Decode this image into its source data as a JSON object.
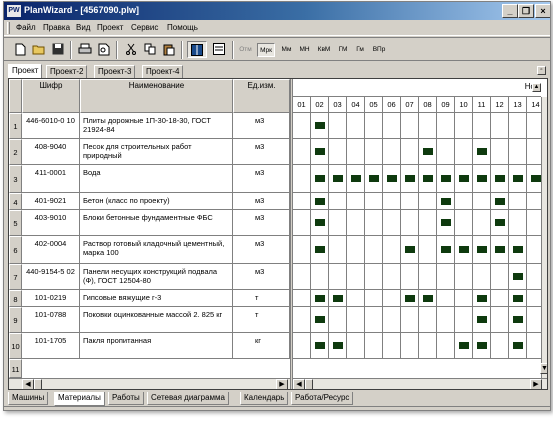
{
  "window": {
    "app_icon": "PW",
    "title": "PlanWizard - [4567090.plw]",
    "controls": [
      {
        "name": "minimize-button",
        "glyph": "_"
      },
      {
        "name": "restore-button",
        "glyph": "❐"
      },
      {
        "name": "close-button",
        "glyph": "×"
      }
    ]
  },
  "menu": {
    "items": [
      "Файл",
      "Правка",
      "Вид",
      "Проект",
      "Сервис",
      "Помощь"
    ]
  },
  "toolbar": {
    "buttons": [
      {
        "name": "new-file-icon"
      },
      {
        "name": "open-folder-icon"
      },
      {
        "name": "save-icon"
      },
      {
        "name": "print-icon"
      },
      {
        "name": "print-preview-icon"
      },
      {
        "name": "cut-icon"
      },
      {
        "name": "copy-icon"
      },
      {
        "name": "paste-icon"
      },
      {
        "name": "table-view-icon",
        "pressed": true
      },
      {
        "name": "chart-view-icon",
        "pressed": false
      }
    ],
    "scales": [
      {
        "label": "Отм",
        "state": "disabled"
      },
      {
        "label": "Мрк",
        "state": "selected"
      },
      {
        "label": "Мм",
        "state": "normal"
      },
      {
        "label": "МН",
        "state": "normal"
      },
      {
        "label": "КвМ",
        "state": "normal"
      },
      {
        "label": "ГМ",
        "state": "normal"
      },
      {
        "label": "Гм",
        "state": "normal"
      },
      {
        "label": "ВПр",
        "state": "normal"
      }
    ]
  },
  "project_tabs": [
    "Проект",
    "Проект-2",
    "Проект-3",
    "Проект-4"
  ],
  "active_project_tab": 0,
  "table": {
    "headers": {
      "code": "Шифр",
      "name": "Наименование",
      "unit": "Ед.изм."
    },
    "rows": [
      {
        "num": "1",
        "code": "446-6010-0 10",
        "name": "Плиты дорожные 1П-30-18-30, ГОСТ 21924-84",
        "unit": "м3",
        "bars": [
          2
        ]
      },
      {
        "num": "2",
        "code": "408-9040",
        "name": "Песок для строительных работ природный",
        "unit": "м3",
        "bars": [
          2,
          8,
          11
        ]
      },
      {
        "num": "3",
        "code": "411-0001",
        "name": "Вода",
        "unit": "м3",
        "bars": [
          2,
          3,
          4,
          5,
          6,
          7,
          8,
          9,
          10,
          11,
          12,
          13,
          14
        ]
      },
      {
        "num": "4",
        "code": "401-9021",
        "name": "Бетон  (класс по проекту)",
        "unit": "м3",
        "bars": [
          2,
          9,
          12
        ]
      },
      {
        "num": "5",
        "code": "403-9010",
        "name": "Блоки бетонные фундаментные ФБС",
        "unit": "м3",
        "bars": [
          2,
          9,
          12
        ]
      },
      {
        "num": "6",
        "code": "402-0004",
        "name": "Раствор готовый кладочный цементный, марка 100",
        "unit": "м3",
        "bars": [
          2,
          7,
          9,
          10,
          11,
          12,
          13
        ]
      },
      {
        "num": "7",
        "code": "440-9154-5 02",
        "name": "Панели несущих конструкций подвала (Ф), ГОСТ 12504-80",
        "unit": "м3",
        "bars": [
          13
        ]
      },
      {
        "num": "8",
        "code": "101-0219",
        "name": "Гипсовые вяжущие г-3",
        "unit": "т",
        "bars": [
          2,
          3,
          7,
          8,
          11,
          13
        ]
      },
      {
        "num": "9",
        "code": "101-0788",
        "name": "Поковки оцинкованные массой 2. 825 кг",
        "unit": "т",
        "bars": [
          2,
          11,
          13
        ]
      },
      {
        "num": "10",
        "code": "101-1705",
        "name": "Пакля пропитанная",
        "unit": "кг",
        "bars": [
          2,
          3,
          10,
          11,
          13
        ]
      }
    ],
    "partial_row_num": "11"
  },
  "gantt": {
    "period_label": "Но",
    "days": [
      "01",
      "02",
      "03",
      "04",
      "05",
      "06",
      "07",
      "08",
      "09",
      "10",
      "11",
      "12",
      "13",
      "14"
    ]
  },
  "bottom_tabs": [
    "Машины",
    "Материалы",
    "Работы",
    "Сетевая диаграмма",
    "Календарь",
    "Работа/Ресурс"
  ],
  "active_bottom_tab": 1,
  "colors": {
    "bar": "#0e3a0e",
    "title_start": "#0a246a",
    "title_end": "#a6caf0",
    "face": "#d4d0c8"
  }
}
